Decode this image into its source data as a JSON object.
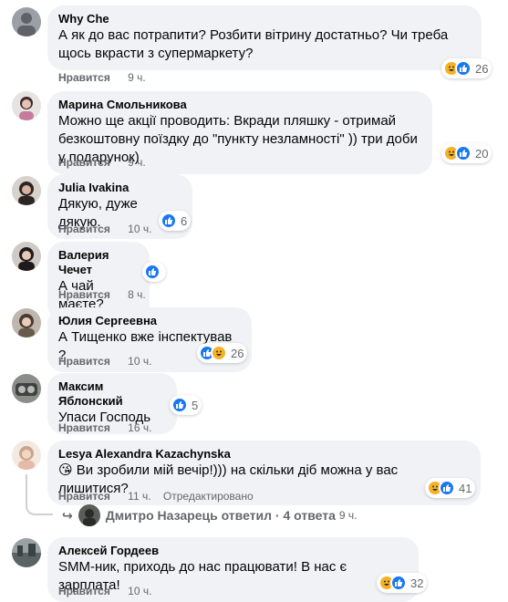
{
  "comments": [
    {
      "author": "Why Che",
      "text": "А як до вас потрапити? Розбити вітрину достатньо? Чи треба щось вкрасти з супермаркету?",
      "like": "Нравится",
      "time": "9 ч.",
      "reactions": [
        "haha",
        "like"
      ],
      "count": "26"
    },
    {
      "author": "Марина Смольникова",
      "text": "Можно ще акції проводить: Вкради пляшку - отримай безкоштовну поїздку до \"пункту незламності\" )) три доби у подарунок)",
      "like": "Нравится",
      "time": "9 ч.",
      "reactions": [
        "haha",
        "like"
      ],
      "count": "20"
    },
    {
      "author": "Julia Ivakina",
      "text": "Дякую, дуже дякую.",
      "like": "Нравится",
      "time": "10 ч.",
      "reactions": [
        "like"
      ],
      "count": "6"
    },
    {
      "author": "Валерия Чечет",
      "text": "А чай маєте?",
      "like": "Нравится",
      "time": "8 ч.",
      "reactions": [
        "like"
      ],
      "count": ""
    },
    {
      "author": "Юлия Сергеевна",
      "text": "А Тищенко вже інспектував ?",
      "like": "Нравится",
      "time": "10 ч.",
      "reactions": [
        "like",
        "haha"
      ],
      "count": "26"
    },
    {
      "author": "Максим Яблонский",
      "text": "Упаси Господь",
      "like": "Нравится",
      "time": "16 ч.",
      "reactions": [
        "like"
      ],
      "count": "5"
    },
    {
      "author": "Lesya Alexandra Kazachynska",
      "text": "😘 Ви зробили мій вечір!))) на скільки діб можна у вас лишитися?",
      "like": "Нравится",
      "time": "11 ч.",
      "edited": "Отредактировано",
      "reactions": [
        "haha",
        "like"
      ],
      "count": "41"
    },
    {
      "author": "Алексей Гордеев",
      "text": "SMM-ник, приходь до нас працювати! В нас є зарплата!",
      "like": "Нравится",
      "time": "10 ч.",
      "reactions": [
        "haha",
        "like"
      ],
      "count": "32"
    }
  ],
  "reply_link": {
    "text": "Дмитро Назарець ответил · 4 ответа",
    "time": "9 ч."
  },
  "colors": {
    "like_blue": "#1877f2",
    "haha_yellow": "#f7b125",
    "bubble_bg": "#f0f2f5",
    "meta_gray": "#65676b"
  }
}
